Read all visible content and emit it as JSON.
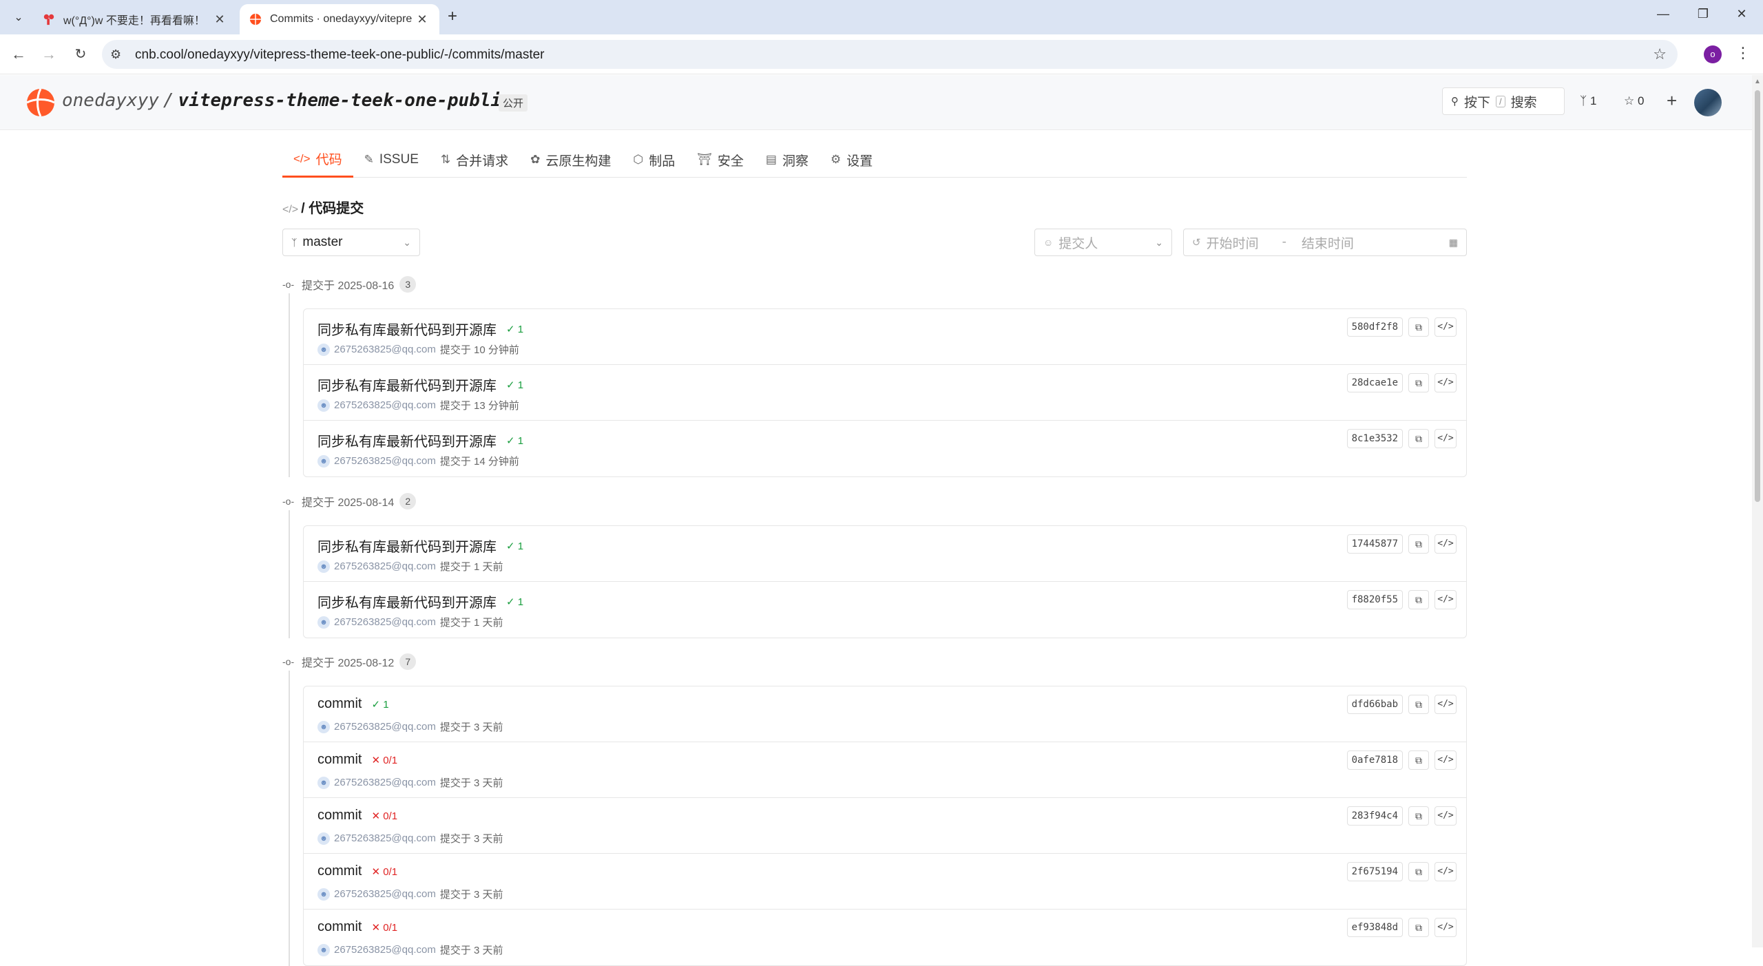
{
  "browser": {
    "tabs": [
      {
        "title": "w(°Д°)w 不要走！再看看嘛！",
        "active": false
      },
      {
        "title": "Commits · onedayxyy/vitepre",
        "active": true
      }
    ],
    "new_tab": "+",
    "url": "cnb.cool/onedayxyy/vitepress-theme-teek-one-public/-/commits/master",
    "profile_initial": "o"
  },
  "header": {
    "owner": "onedayxyy",
    "separator": "/",
    "repo": "vitepress-theme-teek-one-public",
    "visibility": "公开",
    "search_label": "按下",
    "search_key": "/",
    "search_text": "搜索",
    "fork_count": "1",
    "star_count": "0",
    "accent_color": "#ff4f1e"
  },
  "nav": {
    "tabs": [
      {
        "label": "代码",
        "icon": "code-icon",
        "active": true
      },
      {
        "label": "ISSUE",
        "icon": "issue-icon",
        "active": false
      },
      {
        "label": "合并请求",
        "icon": "merge-request-icon",
        "active": false
      },
      {
        "label": "云原生构建",
        "icon": "build-icon",
        "active": false
      },
      {
        "label": "制品",
        "icon": "package-icon",
        "active": false
      },
      {
        "label": "安全",
        "icon": "shield-icon",
        "active": false
      },
      {
        "label": "洞察",
        "icon": "insights-icon",
        "active": false
      },
      {
        "label": "设置",
        "icon": "gear-icon",
        "active": false
      }
    ]
  },
  "page": {
    "breadcrumb": "/ 代码提交",
    "branch": "master",
    "committer_placeholder": "提交人",
    "start_placeholder": "开始时间",
    "range_separator": "-",
    "end_placeholder": "结束时间"
  },
  "groups": [
    {
      "label": "提交于 2025-08-16",
      "count": "3",
      "commits": [
        {
          "message": "同步私有库最新代码到开源库",
          "status": "success",
          "status_text": "1",
          "email": "2675263825@qq.com",
          "time": "提交于 10 分钟前",
          "sha": "580df2f8"
        },
        {
          "message": "同步私有库最新代码到开源库",
          "status": "success",
          "status_text": "1",
          "email": "2675263825@qq.com",
          "time": "提交于 13 分钟前",
          "sha": "28dcae1e"
        },
        {
          "message": "同步私有库最新代码到开源库",
          "status": "success",
          "status_text": "1",
          "email": "2675263825@qq.com",
          "time": "提交于 14 分钟前",
          "sha": "8c1e3532"
        }
      ]
    },
    {
      "label": "提交于 2025-08-14",
      "count": "2",
      "commits": [
        {
          "message": "同步私有库最新代码到开源库",
          "status": "success",
          "status_text": "1",
          "email": "2675263825@qq.com",
          "time": "提交于 1 天前",
          "sha": "17445877"
        },
        {
          "message": "同步私有库最新代码到开源库",
          "status": "success",
          "status_text": "1",
          "email": "2675263825@qq.com",
          "time": "提交于 1 天前",
          "sha": "f8820f55"
        }
      ]
    },
    {
      "label": "提交于 2025-08-12",
      "count": "7",
      "commits": [
        {
          "message": "commit",
          "status": "success",
          "status_text": "1",
          "email": "2675263825@qq.com",
          "time": "提交于 3 天前",
          "sha": "dfd66bab"
        },
        {
          "message": "commit",
          "status": "failed",
          "status_text": "0/1",
          "email": "2675263825@qq.com",
          "time": "提交于 3 天前",
          "sha": "0afe7818"
        },
        {
          "message": "commit",
          "status": "failed",
          "status_text": "0/1",
          "email": "2675263825@qq.com",
          "time": "提交于 3 天前",
          "sha": "283f94c4"
        },
        {
          "message": "commit",
          "status": "failed",
          "status_text": "0/1",
          "email": "2675263825@qq.com",
          "time": "提交于 3 天前",
          "sha": "2f675194"
        },
        {
          "message": "commit",
          "status": "failed",
          "status_text": "0/1",
          "email": "2675263825@qq.com",
          "time": "提交于 3 天前",
          "sha": "ef93848d"
        }
      ]
    }
  ]
}
